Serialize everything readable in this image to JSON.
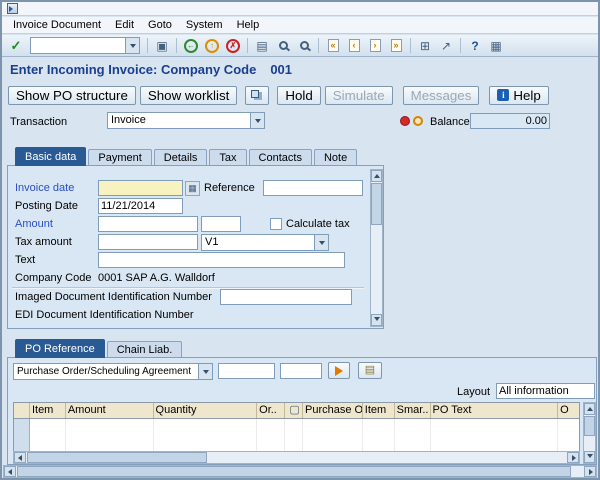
{
  "menu": {
    "items": [
      "Invoice Document",
      "Edit",
      "Goto",
      "System",
      "Help"
    ]
  },
  "toolbar": {
    "command_value": ""
  },
  "page": {
    "title": "Enter Incoming Invoice: Company Code",
    "company_code": "001"
  },
  "app_toolbar": {
    "show_po_structure": "Show PO structure",
    "show_worklist": "Show worklist",
    "hold": "Hold",
    "simulate": "Simulate",
    "messages": "Messages",
    "help": "Help"
  },
  "header_fields": {
    "transaction_label": "Transaction",
    "transaction_value": "Invoice",
    "balance_label": "Balance",
    "balance_value": "0.00"
  },
  "tabs": {
    "basic_data": "Basic data",
    "payment": "Payment",
    "details": "Details",
    "tax": "Tax",
    "contacts": "Contacts",
    "note": "Note"
  },
  "basic_data": {
    "invoice_date_label": "Invoice date",
    "invoice_date_value": "",
    "reference_label": "Reference",
    "reference_value": "",
    "posting_date_label": "Posting Date",
    "posting_date_value": "11/21/2014",
    "amount_label": "Amount",
    "amount_value": "",
    "currency_value": "",
    "calculate_tax_label": "Calculate tax",
    "tax_amount_label": "Tax amount",
    "tax_amount_value": "",
    "tax_code_value": "V1",
    "text_label": "Text",
    "text_value": "",
    "company_code_label": "Company Code",
    "company_code_value": "0001 SAP A.G. Walldorf",
    "imaged_doc_label": "Imaged Document Identification Number",
    "imaged_doc_value": "",
    "edi_doc_label": "EDI Document Identification Number"
  },
  "po_tabs": {
    "po_reference": "PO Reference",
    "chain_liab": "Chain Liab."
  },
  "po_section": {
    "po_type_value": "Purchase Order/Scheduling Agreement",
    "po_number_value": "",
    "po_item_value": "",
    "layout_label": "Layout",
    "layout_value": "All information",
    "table": {
      "headers": [
        "Item",
        "Amount",
        "Quantity",
        "Or..",
        "Purchase O..",
        "Item",
        "Smar..",
        "PO Text",
        "O"
      ]
    }
  },
  "icons": {
    "enter": "✓",
    "save": "▣",
    "back": "←",
    "exit": "↑",
    "cancel": "✗",
    "print": "▤",
    "first_page": "«",
    "prev_page": "‹",
    "next_page": "›",
    "last_page": "»",
    "new_session": "⊞",
    "create_shortcut": "↗",
    "help": "?",
    "customize": "▦",
    "date_picker": "▦",
    "worklist": "▤"
  }
}
